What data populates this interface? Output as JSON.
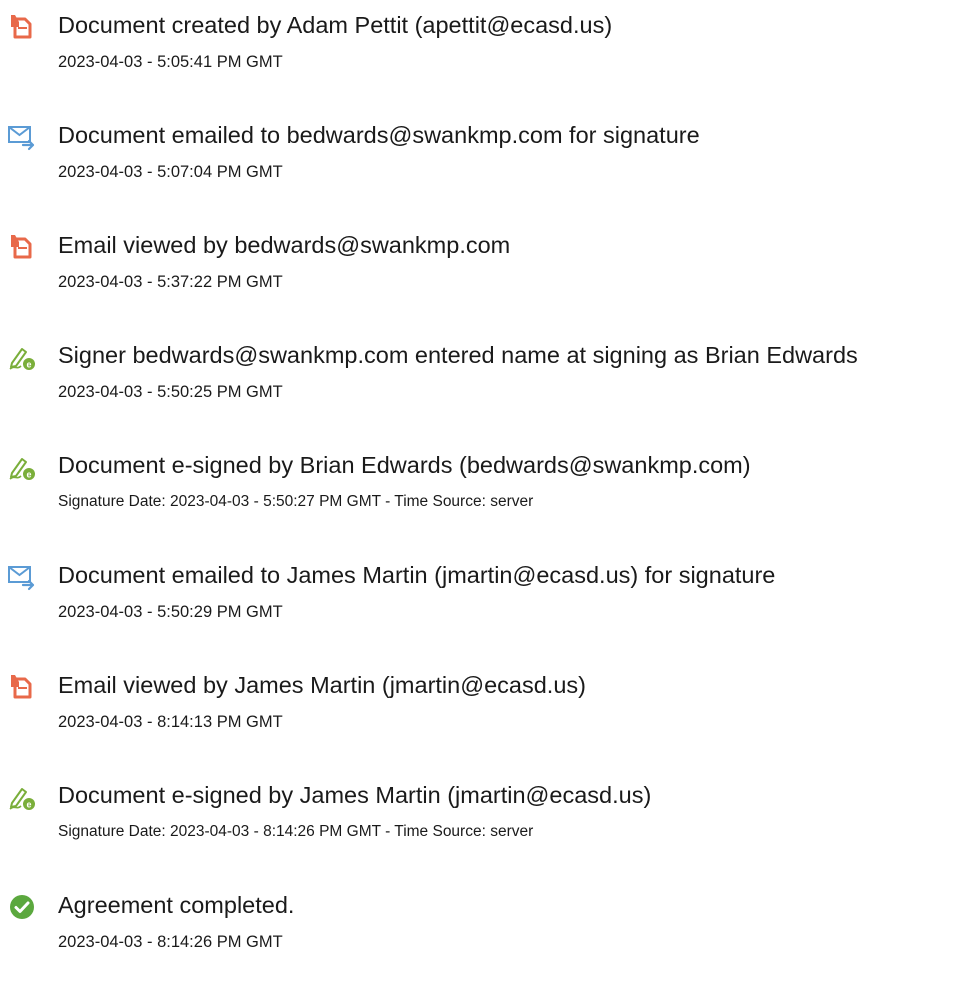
{
  "colors": {
    "document_icon": "#E8694A",
    "email_icon": "#5B9BD5",
    "sign_icon": "#7AAE3A",
    "complete_icon": "#5BA83E"
  },
  "events": [
    {
      "icon": "document-icon",
      "text": "Document created by Adam Pettit (apettit@ecasd.us)",
      "date": "2023-04-03 - 5:05:41 PM GMT"
    },
    {
      "icon": "email-send-icon",
      "text": "Document emailed to bedwards@swankmp.com for signature",
      "date": "2023-04-03 - 5:07:04 PM GMT"
    },
    {
      "icon": "document-icon",
      "text": "Email viewed by bedwards@swankmp.com",
      "date": "2023-04-03 - 5:37:22 PM GMT"
    },
    {
      "icon": "pen-sign-icon",
      "text": "Signer bedwards@swankmp.com entered name at signing as Brian Edwards",
      "date": "2023-04-03 - 5:50:25 PM GMT"
    },
    {
      "icon": "pen-sign-icon",
      "text": "Document e-signed by Brian Edwards (bedwards@swankmp.com)",
      "date": "Signature Date: 2023-04-03 - 5:50:27 PM GMT - Time Source: server"
    },
    {
      "icon": "email-send-icon",
      "text": "Document emailed to James Martin (jmartin@ecasd.us) for signature",
      "date": "2023-04-03 - 5:50:29 PM GMT"
    },
    {
      "icon": "document-icon",
      "text": "Email viewed by James Martin (jmartin@ecasd.us)",
      "date": "2023-04-03 - 8:14:13 PM GMT"
    },
    {
      "icon": "pen-sign-icon",
      "text": "Document e-signed by James Martin (jmartin@ecasd.us)",
      "date": "Signature Date: 2023-04-03 - 8:14:26 PM GMT - Time Source: server"
    },
    {
      "icon": "check-circle-icon",
      "text": "Agreement completed.",
      "date": "2023-04-03 - 8:14:26 PM GMT"
    }
  ]
}
